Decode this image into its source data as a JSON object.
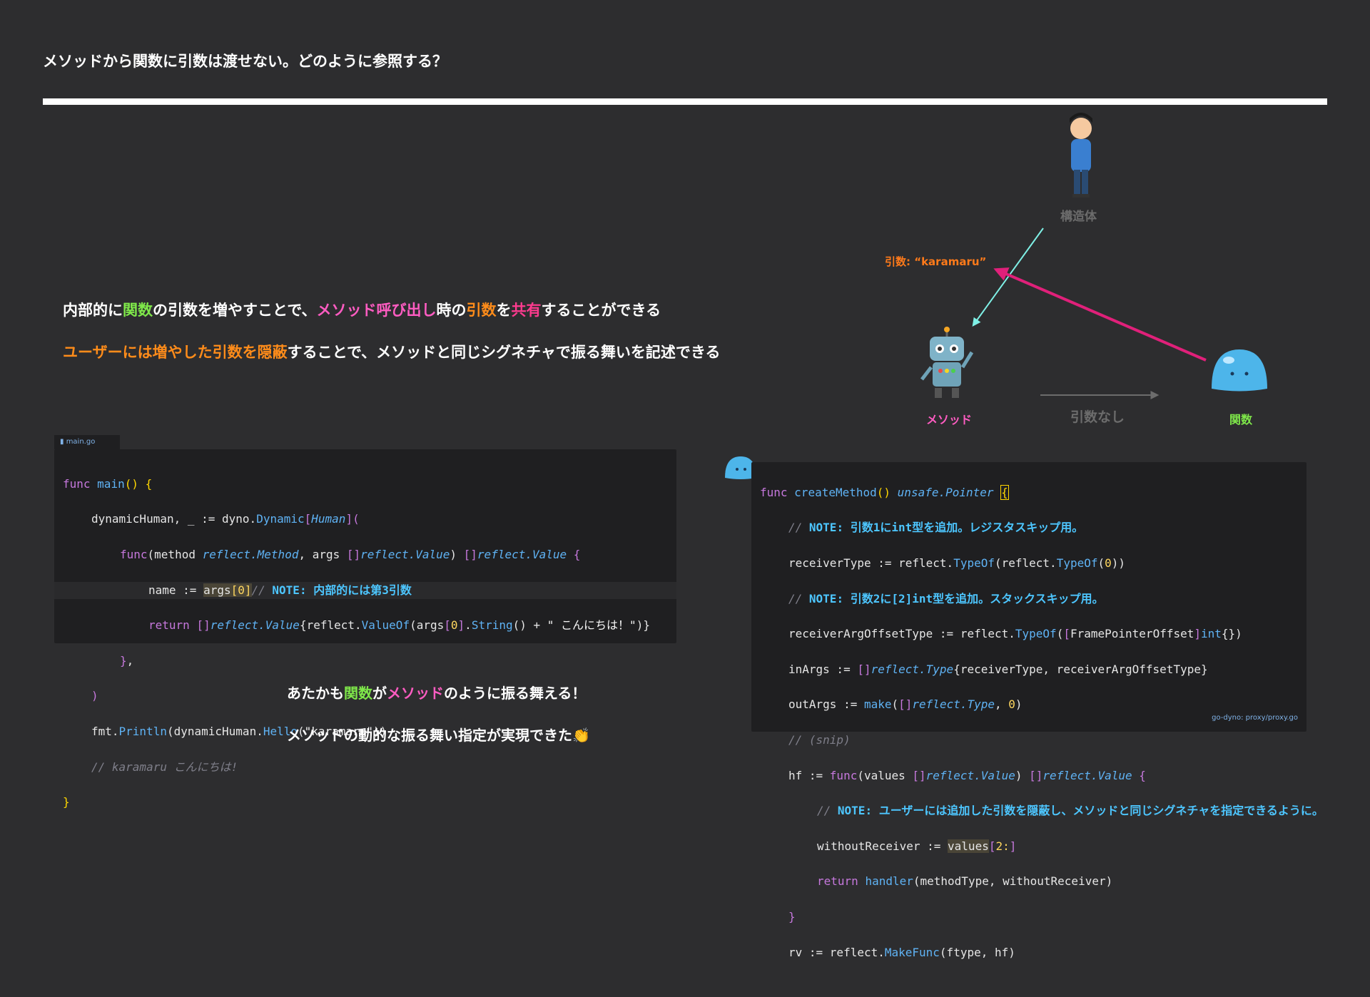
{
  "slide": {
    "title": "メソッドから関数に引数は渡せない。どのように参照する？"
  },
  "points": {
    "p1": [
      "内部的に",
      "関数",
      "の引数を増やすことで、",
      "メソッド呼び出し",
      "時の",
      "引数",
      "を",
      "共有",
      "することができる"
    ],
    "p2": [
      "ユーザーには増やした引数を隠蔽",
      "することで、メソッドと同じシグネチャで振る舞いを記述できる"
    ]
  },
  "diagram": {
    "struct_label": "構造体",
    "arg_label": "引数: “karamaru”",
    "method_label": "メソッド",
    "func_label": "関数",
    "no_arg_label": "引数なし",
    "person_icon": "person-icon",
    "robot_icon": "robot-icon",
    "slime_icon": "slime-icon",
    "colors": {
      "teal_arrow": "#7ff0e6",
      "pink_arrow": "#e0207a",
      "gray_arrow": "#6c6c6c"
    }
  },
  "code_left": {
    "tab": "main.go",
    "lines": [
      "func main() {",
      "dynamicHuman, _ := dyno.Dynamic[Human](",
      "func(method reflect.Method, args []reflect.Value) []reflect.Value {",
      "name := args[0]// NOTE: 内部的には第3引数",
      "return []reflect.Value{reflect.ValueOf(args[0].String() + \" こんにちは！\")}",
      "},",
      ")",
      "fmt.Println(dynamicHuman.Hello(\"karamaru\"))",
      "// karamaru こんにちは!",
      "}"
    ]
  },
  "code_right": {
    "source": "go-dyno: proxy/proxy.go",
    "lines": [
      "func createMethod() unsafe.Pointer {",
      "// NOTE: 引数1にint型を追加。レジスタスキップ用。",
      "receiverType := reflect.TypeOf(reflect.TypeOf(0))",
      "// NOTE: 引数2に[2]int型を追加。スタックスキップ用。",
      "receiverArgOffsetType := reflect.TypeOf([FramePointerOffset]int{})",
      "inArgs := []reflect.Type{receiverType, receiverArgOffsetType}",
      "outArgs := make([]reflect.Type, 0)",
      "// (snip)",
      "hf := func(values []reflect.Value) []reflect.Value {",
      "// NOTE: ユーザーには追加した引数を隠蔽し、メソッドと同じシグネチャを指定できるように。",
      "withoutReceiver := values[2:]",
      "return handler(methodType, withoutReceiver)",
      "}",
      "rv := reflect.MakeFunc(ftype, hf)"
    ]
  },
  "bottom": {
    "line1": [
      "あたかも",
      "関数",
      "が",
      "メソッド",
      "のように振る舞える！"
    ],
    "line2": "メソッドの動的な振る舞い指定が実現できた👏"
  }
}
